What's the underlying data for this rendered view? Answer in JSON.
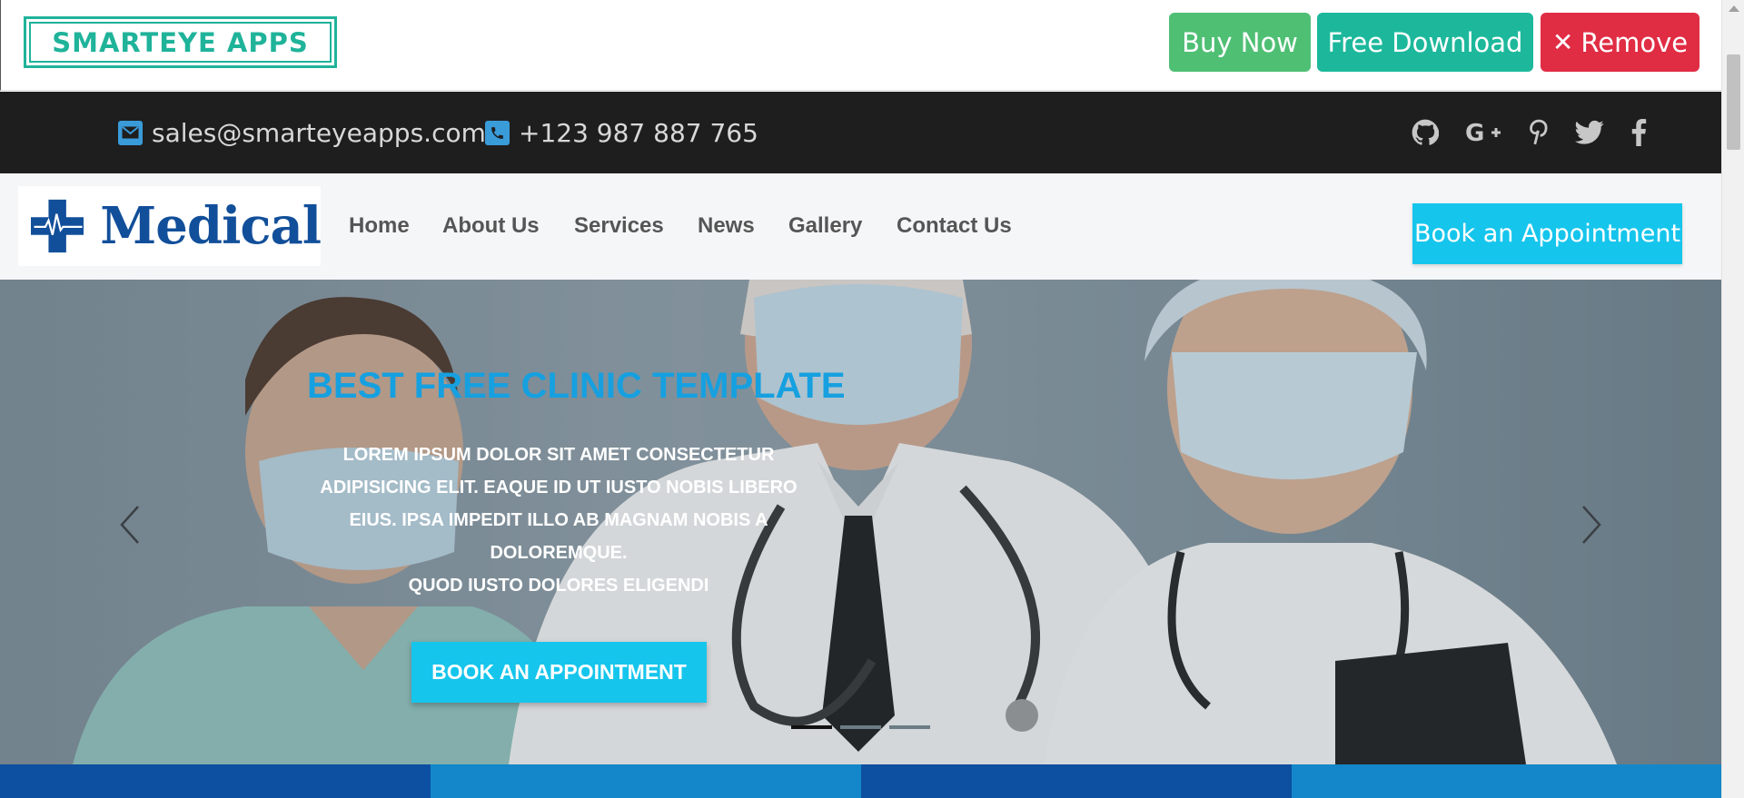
{
  "promo": {
    "brand": "SMARTEYE APPS",
    "buy_label": "Buy Now",
    "free_label": "Free Download",
    "remove_label": "Remove"
  },
  "topbar": {
    "email": "sales@smarteyeapps.com",
    "phone": "+123 987 887 765",
    "social": [
      "github-icon",
      "google-plus-icon",
      "pinterest-icon",
      "twitter-icon",
      "facebook-icon"
    ]
  },
  "nav": {
    "logo_text": "Medical",
    "items": [
      "Home",
      "About Us",
      "Services",
      "News",
      "Gallery",
      "Contact Us"
    ],
    "cta": "Book an Appointment"
  },
  "hero": {
    "title": "BEST FREE CLINIC TEMPLATE",
    "text_line1": "Lorem ipsum dolor sit amet consectetur adipisicing elit. Eaque id ut iusto nobis libero eius. Ipsa impedit illo ab magnam nobis a doloremque.",
    "text_line2": "Quod iusto dolores eligendi",
    "cta": "BOOK AN APPOINTMENT",
    "slides": 3,
    "active_slide": 1
  },
  "colors": {
    "accent": "#16c5ec",
    "brand_green": "#1fb39a",
    "buy": "#4fbf74",
    "remove": "#e02d44",
    "logo_blue": "#124f9a",
    "hero_title": "#16a0e0"
  }
}
